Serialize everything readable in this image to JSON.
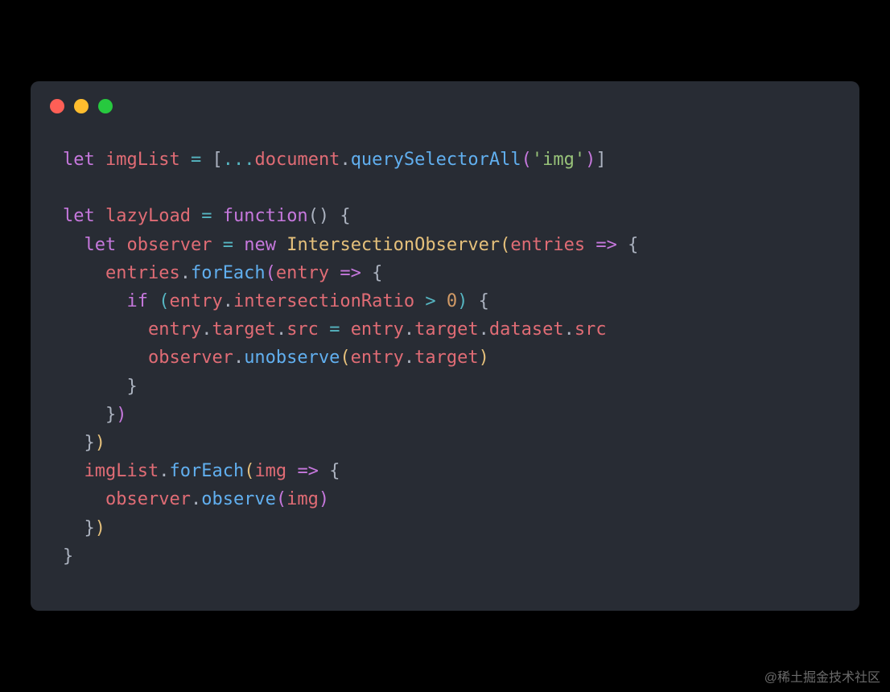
{
  "window": {
    "dots": {
      "red": "#ff5f56",
      "yellow": "#ffbd2e",
      "green": "#27c93f"
    }
  },
  "code": {
    "lines": [
      [
        {
          "t": "let",
          "c": "kw"
        },
        {
          "t": " ",
          "c": "pun"
        },
        {
          "t": "imgList",
          "c": "var"
        },
        {
          "t": " ",
          "c": "pun"
        },
        {
          "t": "=",
          "c": "op"
        },
        {
          "t": " ",
          "c": "pun"
        },
        {
          "t": "[",
          "c": "pun"
        },
        {
          "t": "...",
          "c": "op"
        },
        {
          "t": "document",
          "c": "var"
        },
        {
          "t": ".",
          "c": "pun"
        },
        {
          "t": "querySelectorAll",
          "c": "fn"
        },
        {
          "t": "(",
          "c": "par2"
        },
        {
          "t": "'img'",
          "c": "str"
        },
        {
          "t": ")",
          "c": "par2"
        },
        {
          "t": "]",
          "c": "pun"
        }
      ],
      [],
      [
        {
          "t": "let",
          "c": "kw"
        },
        {
          "t": " ",
          "c": "pun"
        },
        {
          "t": "lazyLoad",
          "c": "var"
        },
        {
          "t": " ",
          "c": "pun"
        },
        {
          "t": "=",
          "c": "op"
        },
        {
          "t": " ",
          "c": "pun"
        },
        {
          "t": "function",
          "c": "kw"
        },
        {
          "t": "() {",
          "c": "pun"
        }
      ],
      [
        {
          "t": "  ",
          "c": "pun"
        },
        {
          "t": "let",
          "c": "kw"
        },
        {
          "t": " ",
          "c": "pun"
        },
        {
          "t": "observer",
          "c": "var"
        },
        {
          "t": " ",
          "c": "pun"
        },
        {
          "t": "=",
          "c": "op"
        },
        {
          "t": " ",
          "c": "pun"
        },
        {
          "t": "new",
          "c": "kw"
        },
        {
          "t": " ",
          "c": "pun"
        },
        {
          "t": "IntersectionObserver",
          "c": "cls"
        },
        {
          "t": "(",
          "c": "par"
        },
        {
          "t": "entries",
          "c": "var"
        },
        {
          "t": " ",
          "c": "pun"
        },
        {
          "t": "=>",
          "c": "kw"
        },
        {
          "t": " ",
          "c": "pun"
        },
        {
          "t": "{",
          "c": "pun"
        }
      ],
      [
        {
          "t": "    ",
          "c": "pun"
        },
        {
          "t": "entries",
          "c": "var"
        },
        {
          "t": ".",
          "c": "pun"
        },
        {
          "t": "forEach",
          "c": "fn"
        },
        {
          "t": "(",
          "c": "par2"
        },
        {
          "t": "entry",
          "c": "var"
        },
        {
          "t": " ",
          "c": "pun"
        },
        {
          "t": "=>",
          "c": "kw"
        },
        {
          "t": " ",
          "c": "pun"
        },
        {
          "t": "{",
          "c": "pun"
        }
      ],
      [
        {
          "t": "      ",
          "c": "pun"
        },
        {
          "t": "if",
          "c": "kw"
        },
        {
          "t": " ",
          "c": "pun"
        },
        {
          "t": "(",
          "c": "par3"
        },
        {
          "t": "entry",
          "c": "var"
        },
        {
          "t": ".",
          "c": "pun"
        },
        {
          "t": "intersectionRatio",
          "c": "var"
        },
        {
          "t": " ",
          "c": "pun"
        },
        {
          "t": ">",
          "c": "op"
        },
        {
          "t": " ",
          "c": "pun"
        },
        {
          "t": "0",
          "c": "num"
        },
        {
          "t": ")",
          "c": "par3"
        },
        {
          "t": " ",
          "c": "pun"
        },
        {
          "t": "{",
          "c": "pun"
        }
      ],
      [
        {
          "t": "        ",
          "c": "pun"
        },
        {
          "t": "entry",
          "c": "var"
        },
        {
          "t": ".",
          "c": "pun"
        },
        {
          "t": "target",
          "c": "var"
        },
        {
          "t": ".",
          "c": "pun"
        },
        {
          "t": "src",
          "c": "var"
        },
        {
          "t": " ",
          "c": "pun"
        },
        {
          "t": "=",
          "c": "op"
        },
        {
          "t": " ",
          "c": "pun"
        },
        {
          "t": "entry",
          "c": "var"
        },
        {
          "t": ".",
          "c": "pun"
        },
        {
          "t": "target",
          "c": "var"
        },
        {
          "t": ".",
          "c": "pun"
        },
        {
          "t": "dataset",
          "c": "var"
        },
        {
          "t": ".",
          "c": "pun"
        },
        {
          "t": "src",
          "c": "var"
        }
      ],
      [
        {
          "t": "        ",
          "c": "pun"
        },
        {
          "t": "observer",
          "c": "var"
        },
        {
          "t": ".",
          "c": "pun"
        },
        {
          "t": "unobserve",
          "c": "fn"
        },
        {
          "t": "(",
          "c": "par"
        },
        {
          "t": "entry",
          "c": "var"
        },
        {
          "t": ".",
          "c": "pun"
        },
        {
          "t": "target",
          "c": "var"
        },
        {
          "t": ")",
          "c": "par"
        }
      ],
      [
        {
          "t": "      }",
          "c": "pun"
        }
      ],
      [
        {
          "t": "    }",
          "c": "pun"
        },
        {
          "t": ")",
          "c": "par2"
        }
      ],
      [
        {
          "t": "  }",
          "c": "pun"
        },
        {
          "t": ")",
          "c": "par"
        }
      ],
      [
        {
          "t": "  ",
          "c": "pun"
        },
        {
          "t": "imgList",
          "c": "var"
        },
        {
          "t": ".",
          "c": "pun"
        },
        {
          "t": "forEach",
          "c": "fn"
        },
        {
          "t": "(",
          "c": "par"
        },
        {
          "t": "img",
          "c": "var"
        },
        {
          "t": " ",
          "c": "pun"
        },
        {
          "t": "=>",
          "c": "kw"
        },
        {
          "t": " ",
          "c": "pun"
        },
        {
          "t": "{",
          "c": "pun"
        }
      ],
      [
        {
          "t": "    ",
          "c": "pun"
        },
        {
          "t": "observer",
          "c": "var"
        },
        {
          "t": ".",
          "c": "pun"
        },
        {
          "t": "observe",
          "c": "fn"
        },
        {
          "t": "(",
          "c": "par2"
        },
        {
          "t": "img",
          "c": "var"
        },
        {
          "t": ")",
          "c": "par2"
        }
      ],
      [
        {
          "t": "  }",
          "c": "pun"
        },
        {
          "t": ")",
          "c": "par"
        }
      ],
      [
        {
          "t": "}",
          "c": "pun"
        }
      ]
    ]
  },
  "watermark": "@稀土掘金技术社区"
}
